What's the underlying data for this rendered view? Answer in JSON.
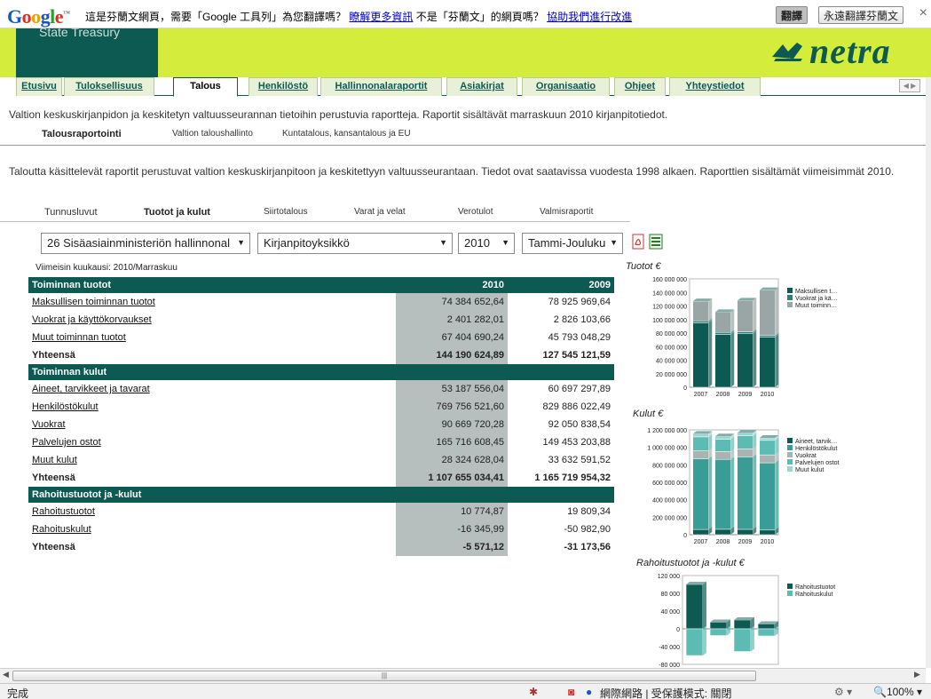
{
  "translate_bar": {
    "logo": "Google",
    "message": "這是芬蘭文網頁，需要「Google 工具列」為您翻譯嗎？",
    "learn_more": "瞭解更多資訊",
    "not_finnish": "不是「芬蘭文」的網頁嗎？",
    "help_improve": "協助我們進行改進",
    "translate_btn": "翻譯",
    "always_btn": "永遠翻譯芬蘭文",
    "close": "×"
  },
  "header": {
    "org_name": "State Treasury",
    "logo_text": "netra"
  },
  "tabs": [
    {
      "label": "Etusivu",
      "active": false
    },
    {
      "label": "Tuloksellisuus",
      "active": false
    },
    {
      "label": "Talous",
      "active": true
    },
    {
      "label": "Henkilöstö",
      "active": false
    },
    {
      "label": "Hallinnonalaraportit",
      "active": false
    },
    {
      "label": "Asiakirjat",
      "active": false
    },
    {
      "label": "Organisaatio",
      "active": false
    },
    {
      "label": "Ohjeet",
      "active": false
    },
    {
      "label": "Yhteystiedot",
      "active": false
    }
  ],
  "intro": "Valtion keskuskirjanpidon ja keskitetyn valtuusseurannan tietoihin perustuvia raportteja. Raportit sisältävät marraskuun 2010 kirjanpitotiedot.",
  "subnav": [
    {
      "label": "Talousraportointi",
      "active": true
    },
    {
      "label": "Valtion taloushallinto",
      "active": false
    },
    {
      "label": "Kuntatalous, kansantalous ja EU",
      "active": false
    }
  ],
  "description": "Taloutta käsittelevät raportit perustuvat valtion keskuskirjanpitoon ja keskitettyyn valtuusseurantaan. Tiedot ovat saatavissa vuodesta 1998 alkaen. Raporttien sisältämät viimeisimmät 2010.",
  "subnav2": [
    {
      "label": "Tunnusluvut",
      "active": false
    },
    {
      "label": "Tuotot ja kulut",
      "active": true
    },
    {
      "label": "Siirtotalous",
      "active": false
    },
    {
      "label": "Varat ja velat",
      "active": false
    },
    {
      "label": "Verotulot",
      "active": false
    },
    {
      "label": "Valmisraportit",
      "active": false
    }
  ],
  "selects": {
    "ministry": "26 Sisäasiainministeriön hallinnonal",
    "unit": "Kirjanpitoyksikkö",
    "year": "2010",
    "period": "Tammi-Jouluku"
  },
  "latest_month": "Viimeisin kuukausi: 2010/Marraskuu",
  "table": {
    "col_2010": "2010",
    "col_2009": "2009",
    "sections": [
      {
        "title": "Toiminnan tuotot",
        "rows": [
          {
            "label": "Maksullisen toiminnan tuotot",
            "v2010": "74 384 652,64",
            "v2009": "78 925 969,64"
          },
          {
            "label": "Vuokrat ja käyttökorvaukset",
            "v2010": "2 401 282,01",
            "v2009": "2 826 103,66"
          },
          {
            "label": "Muut toiminnan tuotot",
            "v2010": "67 404 690,24",
            "v2009": "45 793 048,29"
          }
        ],
        "total": {
          "label": "Yhteensä",
          "v2010": "144 190 624,89",
          "v2009": "127 545 121,59"
        }
      },
      {
        "title": "Toiminnan kulut",
        "rows": [
          {
            "label": "Aineet, tarvikkeet ja tavarat",
            "v2010": "53 187 556,04",
            "v2009": "60 697 297,89"
          },
          {
            "label": "Henkilöstökulut",
            "v2010": "769 756 521,60",
            "v2009": "829 886 022,49"
          },
          {
            "label": "Vuokrat",
            "v2010": "90 669 720,28",
            "v2009": "92 050 838,54"
          },
          {
            "label": "Palvelujen ostot",
            "v2010": "165 716 608,45",
            "v2009": "149 453 203,88"
          },
          {
            "label": "Muut kulut",
            "v2010": "28 324 628,04",
            "v2009": "33 632 591,52"
          }
        ],
        "total": {
          "label": "Yhteensä",
          "v2010": "1 107 655 034,41",
          "v2009": "1 165 719 954,32"
        }
      },
      {
        "title": "Rahoitustuotot ja -kulut",
        "rows": [
          {
            "label": "Rahoitustuotot",
            "v2010": "10 774,87",
            "v2009": "19 809,34"
          },
          {
            "label": "Rahoituskulut",
            "v2010": "-16 345,99",
            "v2009": "-50 982,90"
          }
        ],
        "total": {
          "label": "Yhteensä",
          "v2010": "-5 571,12",
          "v2009": "-31 173,56"
        }
      }
    ]
  },
  "charts": {
    "tuotot": {
      "title": "Tuotot €",
      "yticks": [
        "160 000 000",
        "140 000 000",
        "120 000 000",
        "100 000 000",
        "80 000 000",
        "60 000 000",
        "40 000 000",
        "20 000 000",
        "0"
      ],
      "xticks": [
        "2007",
        "2008",
        "2009",
        "2010"
      ],
      "legend": [
        "Maksullisen t…",
        "Vuokrat ja kä…",
        "Muut toiminn…"
      ]
    },
    "kulut": {
      "title": "Kulut €",
      "yticks": [
        "1 200 000 000",
        "1 000 000 000",
        "800 000 000",
        "600 000 000",
        "400 000 000",
        "200 000 000",
        "0"
      ],
      "xticks": [
        "2007",
        "2008",
        "2009",
        "2010"
      ],
      "legend": [
        "Aineet, tarvik…",
        "Henkilöstökulut",
        "Vuokrat",
        "Palvelujen ostot",
        "Muut kulut"
      ]
    },
    "rahoitus": {
      "title": "Rahoitustuotot ja -kulut €",
      "yticks": [
        "120 000",
        "80 000",
        "40 000",
        "0",
        "-40 000",
        "-80 000"
      ],
      "legend": [
        "Rahoitustuotot",
        "Rahoituskulut"
      ]
    }
  },
  "chart_data": [
    {
      "type": "bar",
      "title": "Tuotot €",
      "categories": [
        "2007",
        "2008",
        "2009",
        "2010"
      ],
      "ylim": [
        0,
        160000000
      ],
      "series": [
        {
          "name": "Maksullisen t…",
          "values": [
            95000000,
            78000000,
            79000000,
            74000000
          ]
        },
        {
          "name": "Vuokrat ja kä…",
          "values": [
            3000000,
            3000000,
            3000000,
            2400000
          ]
        },
        {
          "name": "Muut toiminn…",
          "values": [
            29000000,
            30000000,
            46000000,
            67000000
          ]
        }
      ]
    },
    {
      "type": "bar",
      "title": "Kulut €",
      "categories": [
        "2007",
        "2008",
        "2009",
        "2010"
      ],
      "ylim": [
        0,
        1200000000
      ],
      "series": [
        {
          "name": "Aineet, tarvik…",
          "values": [
            60000000,
            62000000,
            61000000,
            53000000
          ]
        },
        {
          "name": "Henkilöstökulut",
          "values": [
            810000000,
            800000000,
            830000000,
            770000000
          ]
        },
        {
          "name": "Vuokrat",
          "values": [
            90000000,
            90000000,
            92000000,
            91000000
          ]
        },
        {
          "name": "Palvelujen ostot",
          "values": [
            160000000,
            140000000,
            149000000,
            166000000
          ]
        },
        {
          "name": "Muut kulut",
          "values": [
            35000000,
            34000000,
            34000000,
            28000000
          ]
        }
      ]
    },
    {
      "type": "bar",
      "title": "Rahoitustuotot ja -kulut €",
      "categories": [
        "2007",
        "2008",
        "2009",
        "2010"
      ],
      "ylim": [
        -80000,
        120000
      ],
      "series": [
        {
          "name": "Rahoitustuotot",
          "values": [
            100000,
            15000,
            20000,
            11000
          ]
        },
        {
          "name": "Rahoituskulut",
          "values": [
            -60000,
            -15000,
            -51000,
            -16000
          ]
        }
      ]
    }
  ],
  "status": {
    "left": "完成",
    "zone": "網際網路 | 受保護模式: 關閉",
    "zoom": "100%"
  }
}
